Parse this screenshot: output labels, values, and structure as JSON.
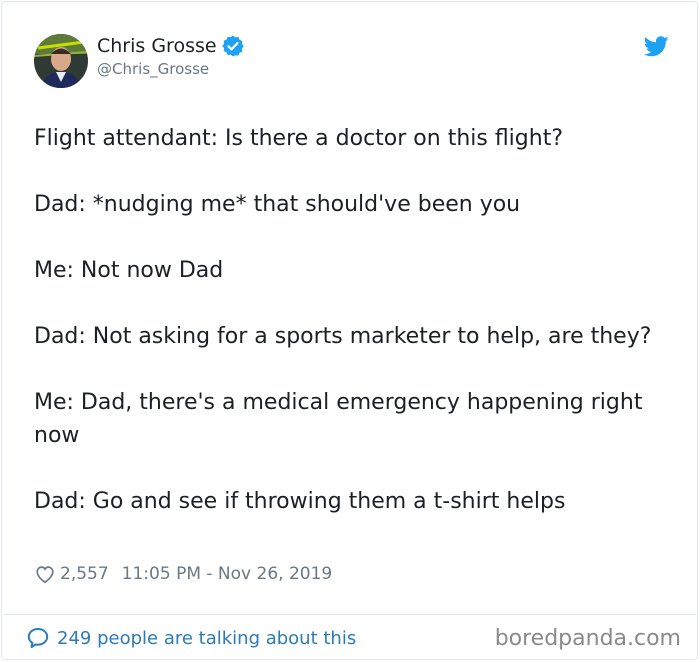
{
  "author": {
    "name": "Chris Grosse",
    "handle": "@Chris_Grosse",
    "verified": true
  },
  "icons": {
    "brand": "twitter-bird-icon",
    "verified": "verified-badge-icon",
    "like": "heart-icon",
    "conversation": "speech-bubble-icon"
  },
  "colors": {
    "twitter_blue": "#1da1f2",
    "link_blue": "#2b7bb9",
    "text": "#1c2022",
    "muted": "#697882"
  },
  "tweet": {
    "lines": [
      "Flight attendant: Is there a doctor on this flight?",
      "Dad: *nudging me* that should've been you",
      "Me: Not now Dad",
      "Dad: Not asking for a sports marketer to help, are they?",
      "Me: Dad, there's a medical emergency happening right now",
      "Dad: Go and see if throwing them a t-shirt helps"
    ],
    "likes": "2,557",
    "timestamp": "11:05 PM - Nov 26, 2019"
  },
  "footer": {
    "conversation_text": "249 people are talking about this",
    "watermark": "boredpanda.com"
  }
}
